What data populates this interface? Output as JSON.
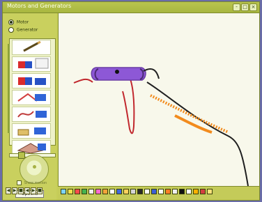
{
  "window": {
    "title": "Motors and Generators",
    "buttons": [
      "-",
      "□",
      "×"
    ]
  },
  "left_panel": {
    "modes": [
      {
        "label": "Motor",
        "selected": true
      },
      {
        "label": "Generator",
        "selected": false
      }
    ],
    "tools": [
      "pencil-tool",
      "magnet-red-tool",
      "magnet-blue-tool",
      "coil-tool",
      "wire-tool",
      "battery-tool",
      "stack-tool"
    ],
    "checkbox_label": "Show motion",
    "options_label": "Options"
  },
  "bottom_bar": {
    "nav_buttons": [
      "◀",
      "▶",
      "■",
      "◀",
      "▶",
      "■"
    ]
  },
  "palette_colors": [
    "#7dd3ff",
    "#f0e04a",
    "#ff4b4b",
    "#45b24f",
    "#f0f0f0",
    "#ff6bcf",
    "#f3a33a",
    "#ffffff",
    "#4169e1",
    "#ffd15e",
    "#d5d5d5",
    "#2b2b2b",
    "#ffffff",
    "#3c5fd6",
    "#f6f6f6",
    "#ff7f27",
    "#efefef",
    "#111111",
    "#ffffff",
    "#ffb000",
    "#d33f3f",
    "#ffe27a"
  ]
}
